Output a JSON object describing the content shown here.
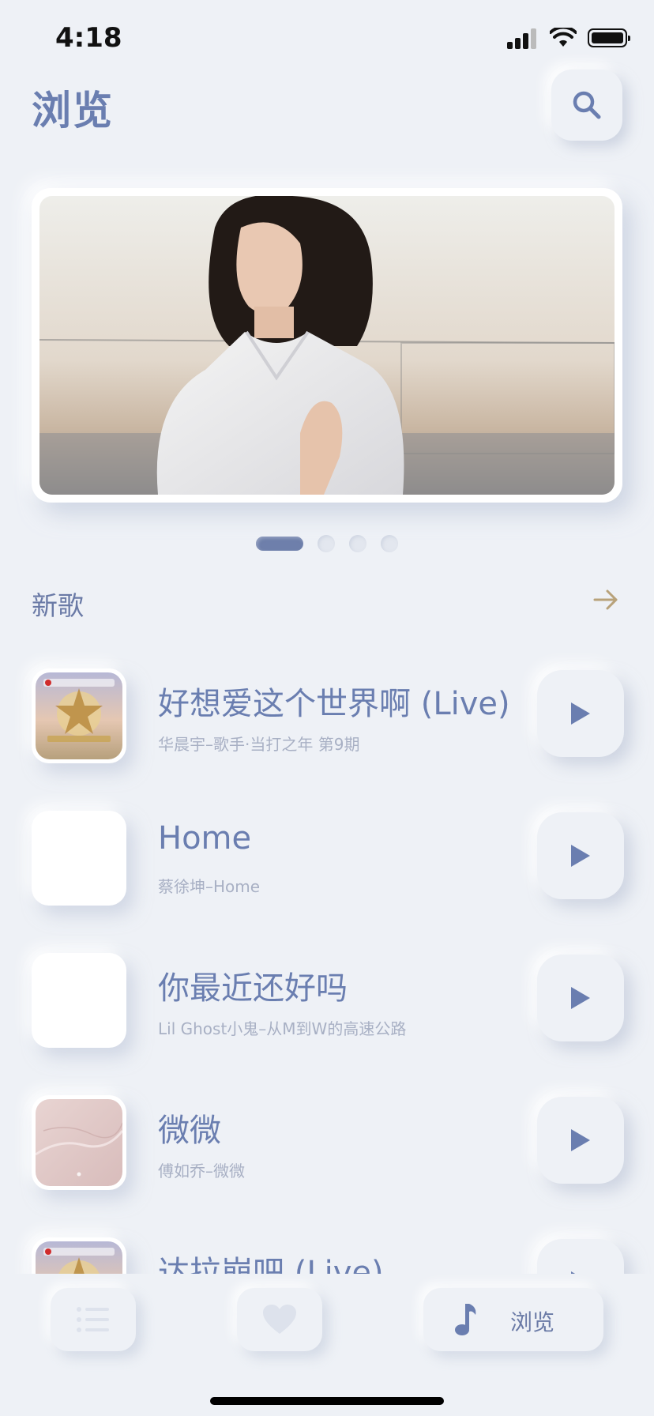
{
  "status": {
    "time": "4:18"
  },
  "header": {
    "title": "浏览"
  },
  "carousel": {
    "page_count": 4,
    "active_index": 0
  },
  "section": {
    "title": "新歌"
  },
  "songs": [
    {
      "title": "好想爱这个世界啊 (Live)",
      "subtitle": "华晨宇–歌手·当打之年 第9期",
      "cover": "singer-show-art"
    },
    {
      "title": "Home",
      "subtitle": "蔡徐坤–Home",
      "cover": "blank"
    },
    {
      "title": "你最近还好吗",
      "subtitle": "Lil Ghost小鬼–从M到W的高速公路",
      "cover": "blank"
    },
    {
      "title": "微微",
      "subtitle": "傅如乔–微微",
      "cover": "pink-texture"
    },
    {
      "title": "达拉崩吧 (Live)",
      "subtitle": "",
      "cover": "singer-show-art"
    }
  ],
  "tabbar": {
    "active_label": "浏览",
    "tabs": [
      "list-icon",
      "heart-icon",
      "music-note-icon"
    ]
  },
  "colors": {
    "accent": "#6a7eb0",
    "background": "#eef1f6",
    "arrow": "#b8a27a"
  }
}
